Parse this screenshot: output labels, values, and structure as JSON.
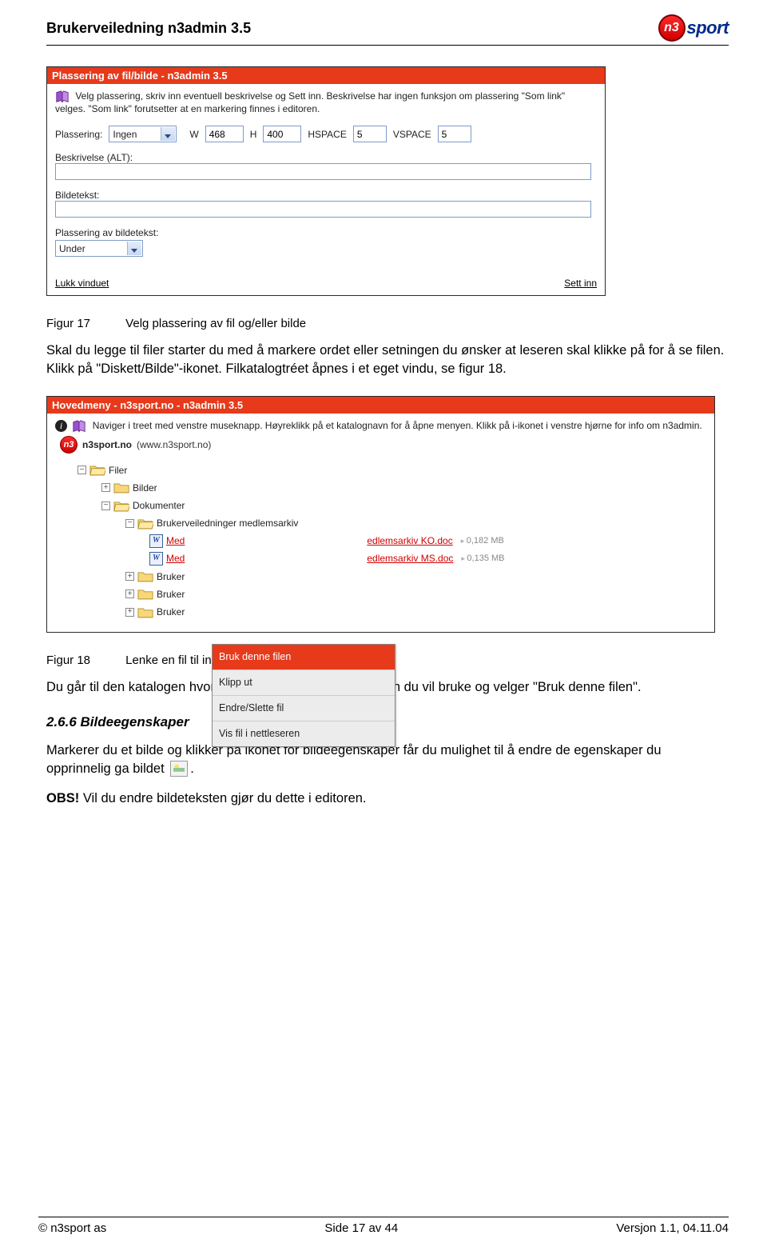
{
  "doc": {
    "header_title": "Brukerveiledning n3admin 3.5",
    "logo_text": "sport",
    "logo_badge": "n3"
  },
  "shot1": {
    "title": "Plassering av fil/bilde - n3admin 3.5",
    "intro": "Velg plassering, skriv inn eventuell beskrivelse og Sett inn. Beskrivelse har ingen funksjon om plassering \"Som link\" velges. \"Som link\" forutsetter at en markering finnes i editoren.",
    "labels": {
      "plassering": "Plassering:",
      "w": "W",
      "h": "H",
      "hspace": "HSPACE",
      "vspace": "VSPACE",
      "beskrivelse": "Beskrivelse (ALT):",
      "bildetekst": "Bildetekst:",
      "plassering_bt": "Plassering av bildetekst:"
    },
    "values": {
      "plassering_sel": "Ingen",
      "w": "468",
      "h": "400",
      "hspace": "5",
      "vspace": "5",
      "plassering_bt_sel": "Under"
    },
    "footer": {
      "left": "Lukk vinduet",
      "right": "Sett inn"
    }
  },
  "fig17": {
    "num": "Figur 17",
    "text": "Velg plassering av fil og/eller bilde"
  },
  "para1": "Skal du legge til filer starter du med å markere ordet eller setningen du ønsker at leseren skal klikke på for å se filen. Klikk på \"Diskett/Bilde\"-ikonet. Filkatalogtréet åpnes i et eget vindu, se figur 18.",
  "shot2": {
    "title": "Hovedmeny - n3sport.no - n3admin 3.5",
    "intro": "Naviger i treet med venstre museknapp. Høyreklikk på et katalognavn for å åpne menyen. Klikk på i-ikonet i venstre hjørne for info om n3admin.",
    "root": {
      "name": "n3sport.no",
      "www": "(www.n3sport.no)"
    },
    "tree": {
      "filer": "Filer",
      "bilder": "Bilder",
      "dokumenter": "Dokumenter",
      "brukerveiledninger": "Brukerveiledninger medlemsarkiv",
      "file1_left": "Med",
      "file1_right": "edlemsarkiv KO.doc",
      "file1_size": "0,182 MB",
      "file2_left": "Med",
      "file2_right": "edlemsarkiv MS.doc",
      "file2_size": "0,135 MB",
      "bruker_item": "Bruker"
    },
    "ctx": {
      "use": "Bruk denne filen",
      "cut": "Klipp ut",
      "edit": "Endre/Slette fil",
      "show": "Vis fil i nettleseren"
    }
  },
  "fig18": {
    "num": "Figur 18",
    "text": "Lenke en fil til innhold i nyhet/artikkel"
  },
  "para2": "Du går til den katalogen hvor filen ligger, høyreklikker på den du vil bruke og velger \"Bruk denne filen\".",
  "sec": {
    "h": "2.6.6 Bildeegenskaper",
    "body_a": "Markerer du et bilde og klikker på ikonet for bildeegenskaper får du mulighet til å endre de egenskaper du opprinnelig ga bildet ",
    "body_b": ".",
    "obs_label": "OBS!",
    "obs_text": " Vil du endre bildeteksten gjør du dette i editoren."
  },
  "footer": {
    "left": "© n3sport as",
    "center": "Side 17 av 44",
    "right": "Versjon 1.1, 04.11.04"
  }
}
